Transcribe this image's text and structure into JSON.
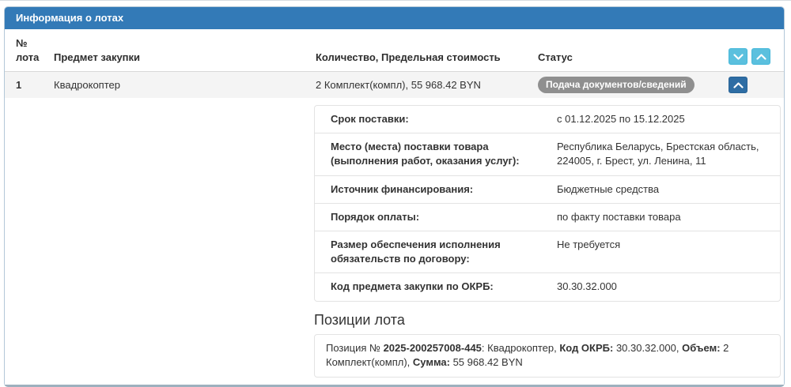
{
  "panel": {
    "title": "Информация о лотах",
    "accent_color": "#337ab7",
    "button_color": "#5bc0de",
    "toggle_color": "#2e6da4",
    "badge_color": "#8f8f8f"
  },
  "table": {
    "headers": {
      "num": "№ лота",
      "subject": "Предмет закупки",
      "quantity": "Количество, Предельная стоимость",
      "status": "Статус"
    },
    "icons": {
      "expand_all": "chevron-down-icon",
      "collapse_all": "chevron-up-icon",
      "row_toggle": "chevron-up-icon"
    },
    "row": {
      "num": "1",
      "subject": "Квадрокоптер",
      "quantity": "2 Комплект(компл), 55 968.42 BYN",
      "status": "Подача документов/сведений"
    }
  },
  "details": {
    "rows": [
      {
        "label": "Срок поставки:",
        "value": "с 01.12.2025 по 15.12.2025"
      },
      {
        "label": "Место (места) поставки товара (выполнения работ, оказания услуг):",
        "value": "Республика Беларусь, Брестская область, 224005, г. Брест, ул. Ленина, 11"
      },
      {
        "label": "Источник финансирования:",
        "value": "Бюджетные средства"
      },
      {
        "label": "Порядок оплаты:",
        "value": "по факту поставки товара"
      },
      {
        "label": "Размер обеспечения исполнения обязательств по договору:",
        "value": "Не требуется"
      },
      {
        "label": "Код предмета закупки по ОКРБ:",
        "value": "30.30.32.000"
      }
    ],
    "positions_title": "Позиции лота",
    "position_segments": [
      {
        "text": "Позиция № ",
        "bold": false
      },
      {
        "text": "2025-200257008-445",
        "bold": true
      },
      {
        "text": ": Квадрокоптер, ",
        "bold": false
      },
      {
        "text": "Код ОКРБ:",
        "bold": true
      },
      {
        "text": " 30.30.32.000, ",
        "bold": false
      },
      {
        "text": "Объем:",
        "bold": true
      },
      {
        "text": " 2 Комплект(компл), ",
        "bold": false
      },
      {
        "text": "Сумма:",
        "bold": true
      },
      {
        "text": " 55 968.42 BYN",
        "bold": false
      }
    ]
  }
}
